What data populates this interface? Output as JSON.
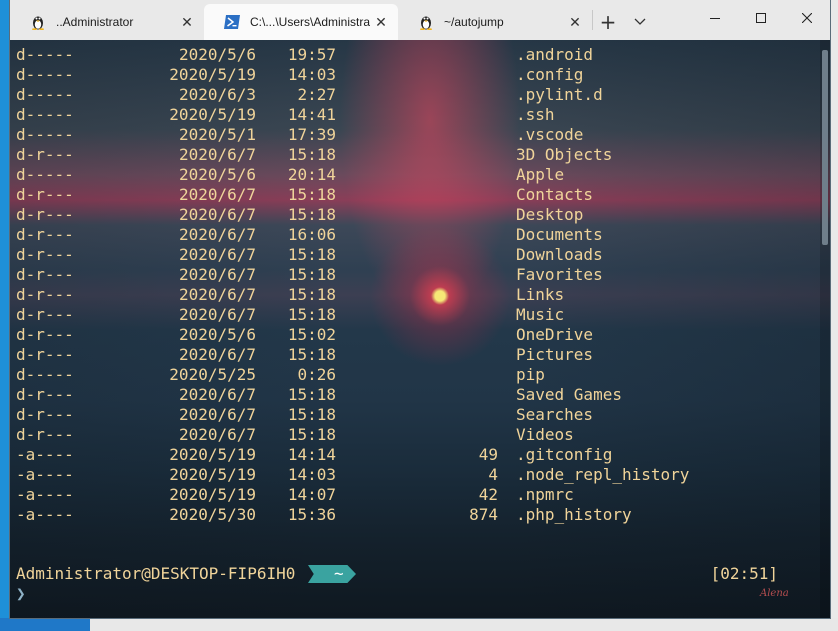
{
  "tabs": [
    {
      "title": "..Administrator",
      "icon": "linux-penguin-icon",
      "active": false
    },
    {
      "title": "C:\\...\\Users\\Administra",
      "icon": "powershell-icon",
      "active": true
    },
    {
      "title": "~/autojump",
      "icon": "linux-penguin-icon",
      "active": false
    }
  ],
  "tabbar": {
    "close_glyph": "✕",
    "add_glyph": "+"
  },
  "listing": [
    {
      "mode": "d-----",
      "date": "2020/5/6",
      "time": "19:57",
      "length": "",
      "name": ".android"
    },
    {
      "mode": "d-----",
      "date": "2020/5/19",
      "time": "14:03",
      "length": "",
      "name": ".config"
    },
    {
      "mode": "d-----",
      "date": "2020/6/3",
      "time": "2:27",
      "length": "",
      "name": ".pylint.d"
    },
    {
      "mode": "d-----",
      "date": "2020/5/19",
      "time": "14:41",
      "length": "",
      "name": ".ssh"
    },
    {
      "mode": "d-----",
      "date": "2020/5/1",
      "time": "17:39",
      "length": "",
      "name": ".vscode"
    },
    {
      "mode": "d-r---",
      "date": "2020/6/7",
      "time": "15:18",
      "length": "",
      "name": "3D Objects"
    },
    {
      "mode": "d-----",
      "date": "2020/5/6",
      "time": "20:14",
      "length": "",
      "name": "Apple"
    },
    {
      "mode": "d-r---",
      "date": "2020/6/7",
      "time": "15:18",
      "length": "",
      "name": "Contacts"
    },
    {
      "mode": "d-r---",
      "date": "2020/6/7",
      "time": "15:18",
      "length": "",
      "name": "Desktop"
    },
    {
      "mode": "d-r---",
      "date": "2020/6/7",
      "time": "16:06",
      "length": "",
      "name": "Documents"
    },
    {
      "mode": "d-r---",
      "date": "2020/6/7",
      "time": "15:18",
      "length": "",
      "name": "Downloads"
    },
    {
      "mode": "d-r---",
      "date": "2020/6/7",
      "time": "15:18",
      "length": "",
      "name": "Favorites"
    },
    {
      "mode": "d-r---",
      "date": "2020/6/7",
      "time": "15:18",
      "length": "",
      "name": "Links"
    },
    {
      "mode": "d-r---",
      "date": "2020/6/7",
      "time": "15:18",
      "length": "",
      "name": "Music"
    },
    {
      "mode": "d-r---",
      "date": "2020/5/6",
      "time": "15:02",
      "length": "",
      "name": "OneDrive"
    },
    {
      "mode": "d-r---",
      "date": "2020/6/7",
      "time": "15:18",
      "length": "",
      "name": "Pictures"
    },
    {
      "mode": "d-----",
      "date": "2020/5/25",
      "time": "0:26",
      "length": "",
      "name": "pip"
    },
    {
      "mode": "d-r---",
      "date": "2020/6/7",
      "time": "15:18",
      "length": "",
      "name": "Saved Games"
    },
    {
      "mode": "d-r---",
      "date": "2020/6/7",
      "time": "15:18",
      "length": "",
      "name": "Searches"
    },
    {
      "mode": "d-r---",
      "date": "2020/6/7",
      "time": "15:18",
      "length": "",
      "name": "Videos"
    },
    {
      "mode": "-a----",
      "date": "2020/5/19",
      "time": "14:14",
      "length": "49",
      "name": ".gitconfig"
    },
    {
      "mode": "-a----",
      "date": "2020/5/19",
      "time": "14:03",
      "length": "4",
      "name": ".node_repl_history"
    },
    {
      "mode": "-a----",
      "date": "2020/5/19",
      "time": "14:07",
      "length": "42",
      "name": ".npmrc"
    },
    {
      "mode": "-a----",
      "date": "2020/5/30",
      "time": "15:36",
      "length": "874",
      "name": ".php_history"
    }
  ],
  "prompt": {
    "user_host": "Administrator@DESKTOP-FIP6IH0",
    "dir": "~",
    "clock": "[02:51]",
    "cursor": "❯"
  },
  "wallpaper_signature": "Alena",
  "colors": {
    "text": "#f0d49a",
    "prompt_segment": "#3aa3a0",
    "accent_sun": "#f04060"
  }
}
